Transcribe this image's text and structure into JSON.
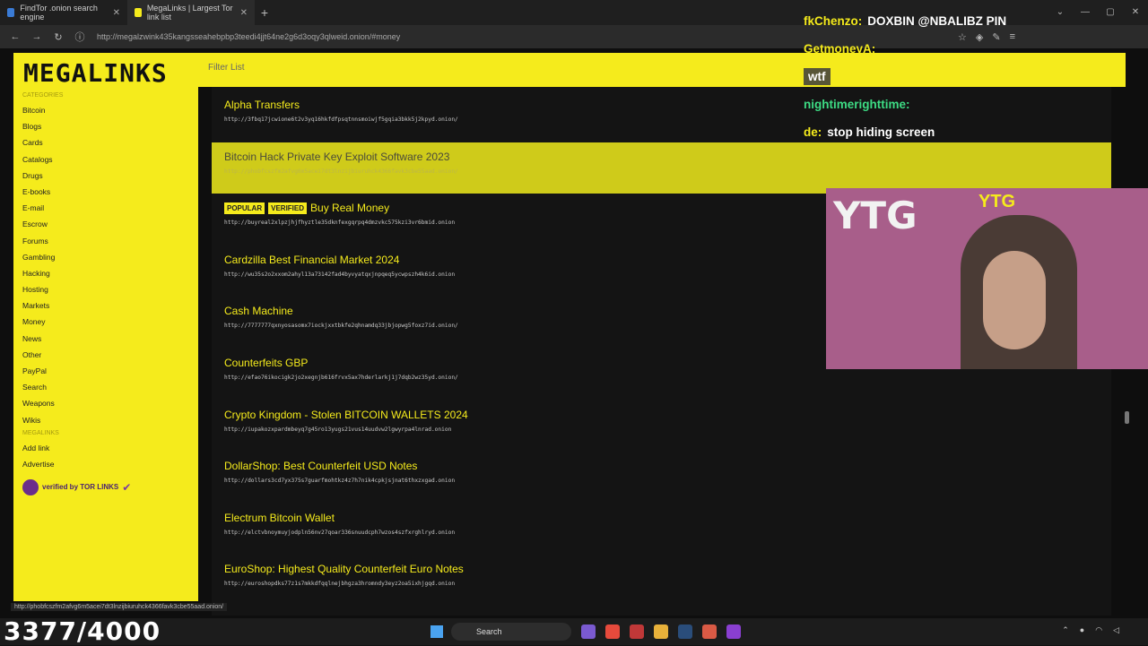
{
  "tabs": [
    {
      "label": "FindTor .onion search engine",
      "active": false
    },
    {
      "label": "MegaLinks | Largest Tor link list",
      "active": true
    }
  ],
  "url": "http://megalzwink435kangsseahebpbp3teedi4jjt64ne2g6d3oqy3qlweid.onion/#money",
  "site": {
    "logo": "MEGALINKS",
    "filter_placeholder": "Filter List"
  },
  "sidebar": {
    "categories_heading": "CATEGORIES",
    "categories": [
      "Bitcoin",
      "Blogs",
      "Cards",
      "Catalogs",
      "Drugs",
      "E-books",
      "E-mail",
      "Escrow",
      "Forums",
      "Gambling",
      "Hacking",
      "Hosting",
      "Markets",
      "Money",
      "News",
      "Other",
      "PayPal",
      "Search",
      "Weapons",
      "Wikis"
    ],
    "megalinks_heading": "MEGALINKS",
    "megalinks": [
      "Add link",
      "Advertise"
    ],
    "badge_text": "verified by TOR LINKS"
  },
  "links": [
    {
      "title": "Alpha Transfers",
      "url": "http://3fbq17jcwione6t2v3yq16hkfdfpsqtnnsmoiwjf5gqia3bkk5j2kpyd.onion/",
      "highlighted": false,
      "tags": []
    },
    {
      "title": "Bitcoin Hack Private Key Exploit Software 2023",
      "url": "http://phobfcszfm2afvg6m5acei7dt3lnzijbiuruhck4366favk3cbe55aad.onion/",
      "highlighted": true,
      "tags": []
    },
    {
      "title": "Buy Real Money",
      "url": "http://buyreal2xlpzjhjfhyztle35dknfexgqrpq4dmzvkc575kzi3vr6bmid.onion",
      "highlighted": false,
      "tags": [
        "POPULAR",
        "VERIFIED"
      ]
    },
    {
      "title": "Cardzilla Best Financial Market 2024",
      "url": "http://wu35s2o2xxom2ahyl13a73142fad4byvyatqxjnpqeq5ycwpszh4k6id.onion",
      "highlighted": false,
      "tags": []
    },
    {
      "title": "Cash Machine",
      "url": "http://7777777qxnyosasomx7iockjxxtbkfe2qhnamdq33jbjopwg5foxz7id.onion/",
      "highlighted": false,
      "tags": []
    },
    {
      "title": "Counterfeits GBP",
      "url": "http://efao76ikocigk2jo2xegnjb616frvx5ax7hderlarkj1j7dqb2wz35yd.onion/",
      "highlighted": false,
      "tags": []
    },
    {
      "title": "Crypto Kingdom - Stolen BITCOIN WALLETS 2024",
      "url": "http://iupakozxpardmbeyq7g45ro13yugs21vus14uudvw2lgwyrpa4lnrad.onion",
      "highlighted": false,
      "tags": []
    },
    {
      "title": "DollarShop: Best Counterfeit USD Notes",
      "url": "http://dollars3cd7yx375s7guarfmohtkz4z7h7nik4cpkjsjnat6thxzxgad.onion",
      "highlighted": false,
      "tags": []
    },
    {
      "title": "Electrum Bitcoin Wallet",
      "url": "http://elctvbnoymuyjodpln56nv27qoar336snuudcph7wzos4szfxrghlryd.onion",
      "highlighted": false,
      "tags": []
    },
    {
      "title": "EuroShop: Highest Quality Counterfeit Euro Notes",
      "url": "http://euroshopdks77z1s7mkkdfqqlnejbhgza3hromndy3eyz2oa5ixhjgqd.onion",
      "highlighted": false,
      "tags": []
    }
  ],
  "status_url": "http://phobfcszfm2afvg6m5acei7dt3lnzijbiuruhck4366favk3cbe55aad.onion/",
  "chat": [
    {
      "user": "fkChenzo:",
      "msg": "DOXBIN @NBALIBZ PIN",
      "user_color": "#f5eb1c"
    },
    {
      "user": "GetmoneyA:",
      "msg": "",
      "user_color": "#f5eb1c"
    },
    {
      "user": "",
      "msg": "wtf",
      "user_color": "#3ddc84"
    },
    {
      "user": "nightimerighttime:",
      "msg": "",
      "user_color": "#3ddc84"
    },
    {
      "user": "de:",
      "msg": "stop hiding screen",
      "user_color": "#f5eb1c"
    }
  ],
  "webcam": {
    "sign_left": "YTG",
    "sign_right": "YTG"
  },
  "counter": "3377/4000",
  "taskbar": {
    "search_label": "Search"
  }
}
